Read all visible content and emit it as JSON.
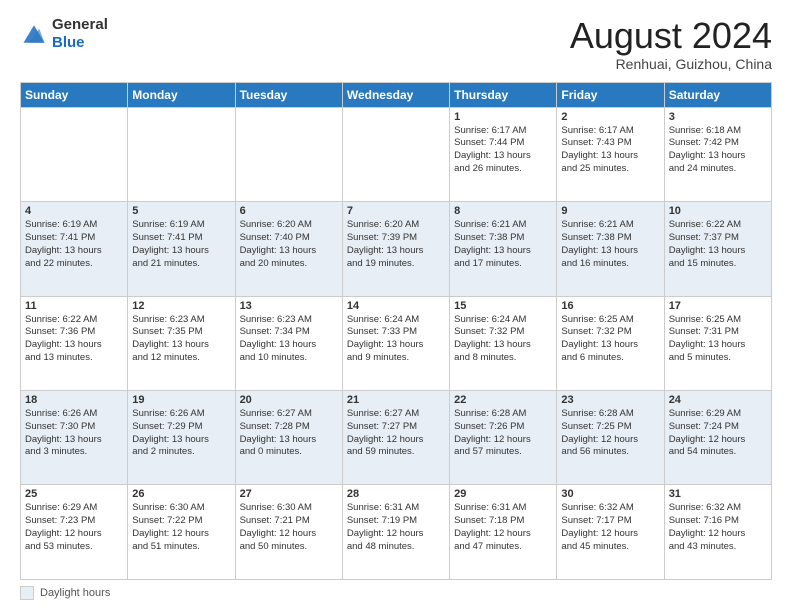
{
  "header": {
    "logo": {
      "line1": "General",
      "line2": "Blue"
    },
    "title": "August 2024",
    "location": "Renhuai, Guizhou, China"
  },
  "days_of_week": [
    "Sunday",
    "Monday",
    "Tuesday",
    "Wednesday",
    "Thursday",
    "Friday",
    "Saturday"
  ],
  "weeks": [
    [
      {
        "day": "",
        "info": ""
      },
      {
        "day": "",
        "info": ""
      },
      {
        "day": "",
        "info": ""
      },
      {
        "day": "",
        "info": ""
      },
      {
        "day": "1",
        "info": "Sunrise: 6:17 AM\nSunset: 7:44 PM\nDaylight: 13 hours\nand 26 minutes."
      },
      {
        "day": "2",
        "info": "Sunrise: 6:17 AM\nSunset: 7:43 PM\nDaylight: 13 hours\nand 25 minutes."
      },
      {
        "day": "3",
        "info": "Sunrise: 6:18 AM\nSunset: 7:42 PM\nDaylight: 13 hours\nand 24 minutes."
      }
    ],
    [
      {
        "day": "4",
        "info": "Sunrise: 6:19 AM\nSunset: 7:41 PM\nDaylight: 13 hours\nand 22 minutes."
      },
      {
        "day": "5",
        "info": "Sunrise: 6:19 AM\nSunset: 7:41 PM\nDaylight: 13 hours\nand 21 minutes."
      },
      {
        "day": "6",
        "info": "Sunrise: 6:20 AM\nSunset: 7:40 PM\nDaylight: 13 hours\nand 20 minutes."
      },
      {
        "day": "7",
        "info": "Sunrise: 6:20 AM\nSunset: 7:39 PM\nDaylight: 13 hours\nand 19 minutes."
      },
      {
        "day": "8",
        "info": "Sunrise: 6:21 AM\nSunset: 7:38 PM\nDaylight: 13 hours\nand 17 minutes."
      },
      {
        "day": "9",
        "info": "Sunrise: 6:21 AM\nSunset: 7:38 PM\nDaylight: 13 hours\nand 16 minutes."
      },
      {
        "day": "10",
        "info": "Sunrise: 6:22 AM\nSunset: 7:37 PM\nDaylight: 13 hours\nand 15 minutes."
      }
    ],
    [
      {
        "day": "11",
        "info": "Sunrise: 6:22 AM\nSunset: 7:36 PM\nDaylight: 13 hours\nand 13 minutes."
      },
      {
        "day": "12",
        "info": "Sunrise: 6:23 AM\nSunset: 7:35 PM\nDaylight: 13 hours\nand 12 minutes."
      },
      {
        "day": "13",
        "info": "Sunrise: 6:23 AM\nSunset: 7:34 PM\nDaylight: 13 hours\nand 10 minutes."
      },
      {
        "day": "14",
        "info": "Sunrise: 6:24 AM\nSunset: 7:33 PM\nDaylight: 13 hours\nand 9 minutes."
      },
      {
        "day": "15",
        "info": "Sunrise: 6:24 AM\nSunset: 7:32 PM\nDaylight: 13 hours\nand 8 minutes."
      },
      {
        "day": "16",
        "info": "Sunrise: 6:25 AM\nSunset: 7:32 PM\nDaylight: 13 hours\nand 6 minutes."
      },
      {
        "day": "17",
        "info": "Sunrise: 6:25 AM\nSunset: 7:31 PM\nDaylight: 13 hours\nand 5 minutes."
      }
    ],
    [
      {
        "day": "18",
        "info": "Sunrise: 6:26 AM\nSunset: 7:30 PM\nDaylight: 13 hours\nand 3 minutes."
      },
      {
        "day": "19",
        "info": "Sunrise: 6:26 AM\nSunset: 7:29 PM\nDaylight: 13 hours\nand 2 minutes."
      },
      {
        "day": "20",
        "info": "Sunrise: 6:27 AM\nSunset: 7:28 PM\nDaylight: 13 hours\nand 0 minutes."
      },
      {
        "day": "21",
        "info": "Sunrise: 6:27 AM\nSunset: 7:27 PM\nDaylight: 12 hours\nand 59 minutes."
      },
      {
        "day": "22",
        "info": "Sunrise: 6:28 AM\nSunset: 7:26 PM\nDaylight: 12 hours\nand 57 minutes."
      },
      {
        "day": "23",
        "info": "Sunrise: 6:28 AM\nSunset: 7:25 PM\nDaylight: 12 hours\nand 56 minutes."
      },
      {
        "day": "24",
        "info": "Sunrise: 6:29 AM\nSunset: 7:24 PM\nDaylight: 12 hours\nand 54 minutes."
      }
    ],
    [
      {
        "day": "25",
        "info": "Sunrise: 6:29 AM\nSunset: 7:23 PM\nDaylight: 12 hours\nand 53 minutes."
      },
      {
        "day": "26",
        "info": "Sunrise: 6:30 AM\nSunset: 7:22 PM\nDaylight: 12 hours\nand 51 minutes."
      },
      {
        "day": "27",
        "info": "Sunrise: 6:30 AM\nSunset: 7:21 PM\nDaylight: 12 hours\nand 50 minutes."
      },
      {
        "day": "28",
        "info": "Sunrise: 6:31 AM\nSunset: 7:19 PM\nDaylight: 12 hours\nand 48 minutes."
      },
      {
        "day": "29",
        "info": "Sunrise: 6:31 AM\nSunset: 7:18 PM\nDaylight: 12 hours\nand 47 minutes."
      },
      {
        "day": "30",
        "info": "Sunrise: 6:32 AM\nSunset: 7:17 PM\nDaylight: 12 hours\nand 45 minutes."
      },
      {
        "day": "31",
        "info": "Sunrise: 6:32 AM\nSunset: 7:16 PM\nDaylight: 12 hours\nand 43 minutes."
      }
    ]
  ],
  "footer": {
    "legend_label": "Daylight hours"
  }
}
